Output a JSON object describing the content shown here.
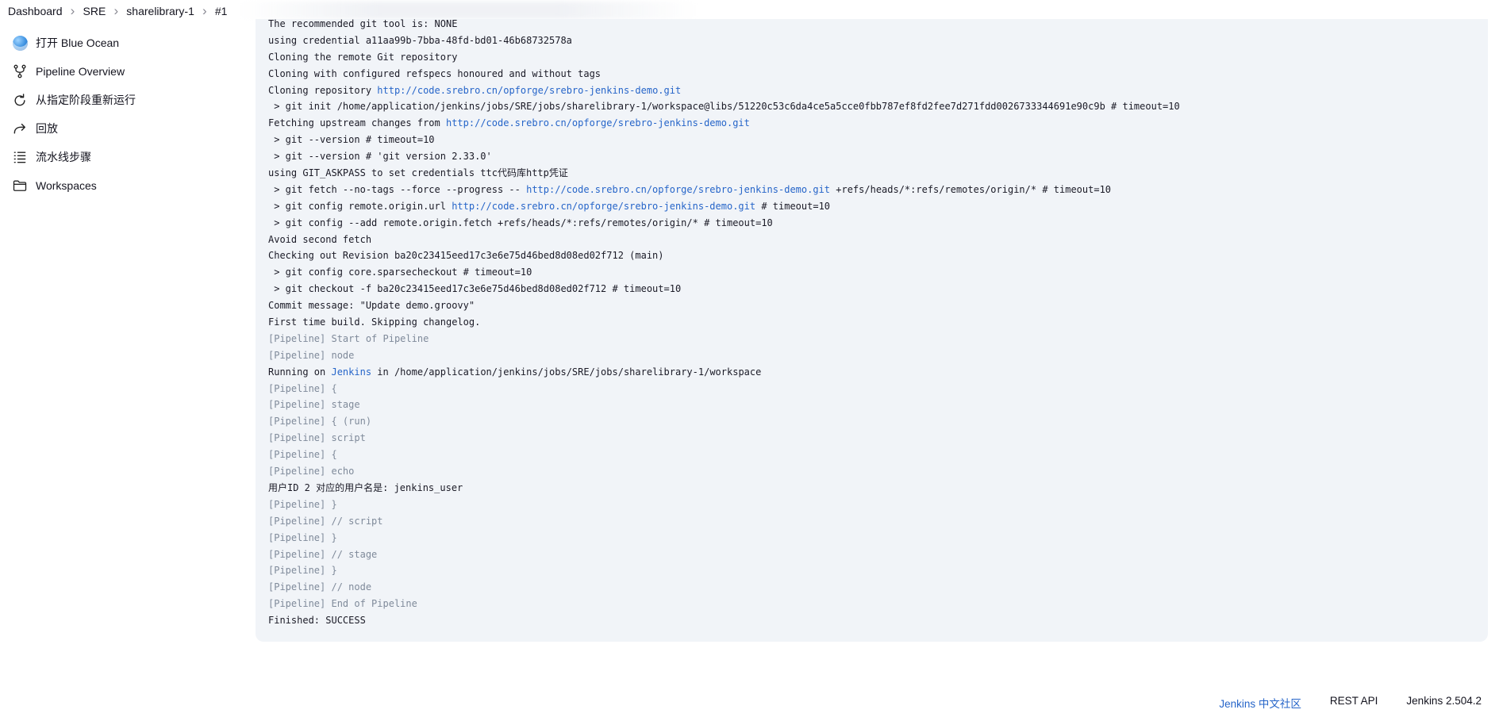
{
  "breadcrumb": [
    {
      "label": "Dashboard"
    },
    {
      "label": "SRE"
    },
    {
      "label": "sharelibrary-1"
    },
    {
      "label": "#1"
    }
  ],
  "sidebar": {
    "items": [
      {
        "label": "打开 Blue Ocean",
        "icon": "blue-ocean-icon"
      },
      {
        "label": "Pipeline Overview",
        "icon": "pipeline-branch-icon"
      },
      {
        "label": "从指定阶段重新运行",
        "icon": "restart-icon"
      },
      {
        "label": "回放",
        "icon": "replay-arrow-icon"
      },
      {
        "label": "流水线步骤",
        "icon": "list-steps-icon"
      },
      {
        "label": "Workspaces",
        "icon": "folder-icon"
      }
    ]
  },
  "console": {
    "lines": [
      {
        "type": "plain",
        "segments": [
          {
            "text": "The recommended git tool is: NONE"
          }
        ]
      },
      {
        "type": "plain",
        "segments": [
          {
            "text": "using credential a11aa99b-7bba-48fd-bd01-46b68732578a"
          }
        ]
      },
      {
        "type": "plain",
        "segments": [
          {
            "text": "Cloning the remote Git repository"
          }
        ]
      },
      {
        "type": "plain",
        "segments": [
          {
            "text": "Cloning with configured refspecs honoured and without tags"
          }
        ]
      },
      {
        "type": "plain",
        "segments": [
          {
            "text": "Cloning repository "
          },
          {
            "text": "http://code.srebro.cn/opforge/srebro-jenkins-demo.git",
            "link": true
          }
        ]
      },
      {
        "type": "plain",
        "segments": [
          {
            "text": " > git init /home/application/jenkins/jobs/SRE/jobs/sharelibrary-1/workspace@libs/51220c53c6da4ce5a5cce0fbb787ef8fd2fee7d271fdd0026733344691e90c9b # timeout=10"
          }
        ]
      },
      {
        "type": "plain",
        "segments": [
          {
            "text": "Fetching upstream changes from "
          },
          {
            "text": "http://code.srebro.cn/opforge/srebro-jenkins-demo.git",
            "link": true
          }
        ]
      },
      {
        "type": "plain",
        "segments": [
          {
            "text": " > git --version # timeout=10"
          }
        ]
      },
      {
        "type": "plain",
        "segments": [
          {
            "text": " > git --version # 'git version 2.33.0'"
          }
        ]
      },
      {
        "type": "plain",
        "segments": [
          {
            "text": "using GIT_ASKPASS to set credentials ttc代码库http凭证"
          }
        ]
      },
      {
        "type": "plain",
        "segments": [
          {
            "text": " > git fetch --no-tags --force --progress -- "
          },
          {
            "text": "http://code.srebro.cn/opforge/srebro-jenkins-demo.git",
            "link": true
          },
          {
            "text": " +refs/heads/*:refs/remotes/origin/* # timeout=10"
          }
        ]
      },
      {
        "type": "plain",
        "segments": [
          {
            "text": " > git config remote.origin.url "
          },
          {
            "text": "http://code.srebro.cn/opforge/srebro-jenkins-demo.git",
            "link": true
          },
          {
            "text": " # timeout=10"
          }
        ]
      },
      {
        "type": "plain",
        "segments": [
          {
            "text": " > git config --add remote.origin.fetch +refs/heads/*:refs/remotes/origin/* # timeout=10"
          }
        ]
      },
      {
        "type": "plain",
        "segments": [
          {
            "text": "Avoid second fetch"
          }
        ]
      },
      {
        "type": "plain",
        "segments": [
          {
            "text": "Checking out Revision ba20c23415eed17c3e6e75d46bed8d08ed02f712 (main)"
          }
        ]
      },
      {
        "type": "plain",
        "segments": [
          {
            "text": " > git config core.sparsecheckout # timeout=10"
          }
        ]
      },
      {
        "type": "plain",
        "segments": [
          {
            "text": " > git checkout -f ba20c23415eed17c3e6e75d46bed8d08ed02f712 # timeout=10"
          }
        ]
      },
      {
        "type": "plain",
        "segments": [
          {
            "text": "Commit message: \"Update demo.groovy\""
          }
        ]
      },
      {
        "type": "plain",
        "segments": [
          {
            "text": "First time build. Skipping changelog."
          }
        ]
      },
      {
        "type": "pipe",
        "segments": [
          {
            "text": "[Pipeline] Start of Pipeline"
          }
        ]
      },
      {
        "type": "pipe",
        "segments": [
          {
            "text": "[Pipeline] node"
          }
        ]
      },
      {
        "type": "plain",
        "segments": [
          {
            "text": "Running on "
          },
          {
            "text": "Jenkins",
            "link": true
          },
          {
            "text": " in /home/application/jenkins/jobs/SRE/jobs/sharelibrary-1/workspace"
          }
        ]
      },
      {
        "type": "pipe",
        "segments": [
          {
            "text": "[Pipeline] {"
          }
        ]
      },
      {
        "type": "pipe",
        "segments": [
          {
            "text": "[Pipeline] stage"
          }
        ]
      },
      {
        "type": "pipe",
        "segments": [
          {
            "text": "[Pipeline] { (run)"
          }
        ]
      },
      {
        "type": "pipe",
        "segments": [
          {
            "text": "[Pipeline] script"
          }
        ]
      },
      {
        "type": "pipe",
        "segments": [
          {
            "text": "[Pipeline] {"
          }
        ]
      },
      {
        "type": "pipe",
        "segments": [
          {
            "text": "[Pipeline] echo"
          }
        ]
      },
      {
        "type": "plain",
        "segments": [
          {
            "text": "用户ID 2 对应的用户名是: jenkins_user"
          }
        ]
      },
      {
        "type": "pipe",
        "segments": [
          {
            "text": "[Pipeline] }"
          }
        ]
      },
      {
        "type": "pipe",
        "segments": [
          {
            "text": "[Pipeline] // script"
          }
        ]
      },
      {
        "type": "pipe",
        "segments": [
          {
            "text": "[Pipeline] }"
          }
        ]
      },
      {
        "type": "pipe",
        "segments": [
          {
            "text": "[Pipeline] // stage"
          }
        ]
      },
      {
        "type": "pipe",
        "segments": [
          {
            "text": "[Pipeline] }"
          }
        ]
      },
      {
        "type": "pipe",
        "segments": [
          {
            "text": "[Pipeline] // node"
          }
        ]
      },
      {
        "type": "pipe",
        "segments": [
          {
            "text": "[Pipeline] End of Pipeline"
          }
        ]
      },
      {
        "type": "plain",
        "segments": [
          {
            "text": "Finished: SUCCESS"
          }
        ]
      }
    ]
  },
  "footer": {
    "community_link": "Jenkins 中文社区",
    "rest_api": "REST API",
    "version": "Jenkins 2.504.2"
  },
  "colors": {
    "link": "#2665c9",
    "pipeline_text": "#7f8a9a",
    "console_bg": "#f1f4f8"
  }
}
